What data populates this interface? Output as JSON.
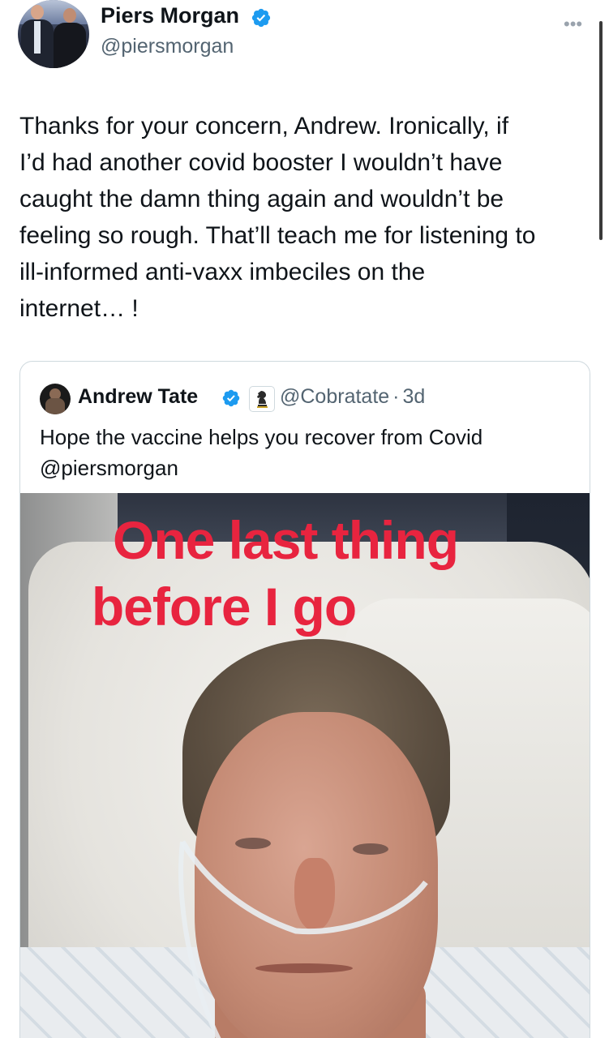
{
  "author": {
    "name": "Piers Morgan",
    "handle": "@piersmorgan",
    "verified": true
  },
  "menu": {
    "more_label": "•••"
  },
  "tweet": {
    "lines": [
      "Thanks for your concern, Andrew. Ironically, if",
      "I’d had another covid booster I wouldn’t have",
      "caught the damn thing again and wouldn’t be",
      "feeling so rough. That’ll teach me for listening to",
      "ill-informed anti-vaxx imbeciles on the",
      "internet… !"
    ]
  },
  "quoted": {
    "name": "Andrew Tate",
    "handle": "@Cobratate",
    "separator": "·",
    "age": "3d",
    "verified": true,
    "badge_icon": "chess-knight-icon",
    "lines": [
      "Hope the vaccine helps you recover from Covid",
      "@piersmorgan"
    ],
    "media": {
      "overlay_line1": "One last thing",
      "overlay_line2": "before I go"
    }
  },
  "colors": {
    "verified_blue": "#1d9bf0",
    "text": "#0f1419",
    "muted": "#536471",
    "overlay_red": "#e8243f",
    "border": "#cfd9de"
  }
}
